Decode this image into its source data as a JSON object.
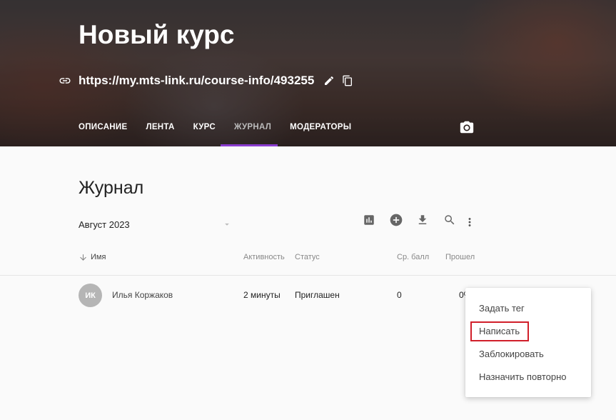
{
  "header": {
    "course_title": "Новый курс",
    "course_url": "https://my.mts-link.ru/course-info/493255",
    "link_icon": "link-icon",
    "edit_icon": "pencil-icon",
    "copy_icon": "copy-icon",
    "camera_icon": "camera-icon",
    "tabs": [
      {
        "label": "ОПИСАНИЕ",
        "active": false
      },
      {
        "label": "ЛЕНТА",
        "active": false
      },
      {
        "label": "КУРС",
        "active": false
      },
      {
        "label": "ЖУРНАЛ",
        "active": true
      },
      {
        "label": "МОДЕРАТОРЫ",
        "active": false
      }
    ],
    "active_tab_color": "#8a3ccf"
  },
  "journal": {
    "title": "Журнал",
    "month": "Август 2023",
    "toolbar_icons": [
      "chart-icon",
      "add-icon",
      "download-icon",
      "search-icon",
      "more-vert-icon"
    ],
    "columns": {
      "name": "Имя",
      "activity": "Активность",
      "status": "Статус",
      "avg_score": "Ср. балл",
      "passed": "Прошел"
    },
    "rows": [
      {
        "initials": "ИК",
        "name": "Илья Коржаков",
        "activity": "2 минуты",
        "status": "Приглашен",
        "avg_score": "0",
        "passed": "0%"
      }
    ]
  },
  "context_menu": {
    "items": [
      "Задать тег",
      "Написать",
      "Заблокировать",
      "Назначить повторно"
    ],
    "highlighted": "Написать",
    "highlight_color": "#d11f2a"
  }
}
